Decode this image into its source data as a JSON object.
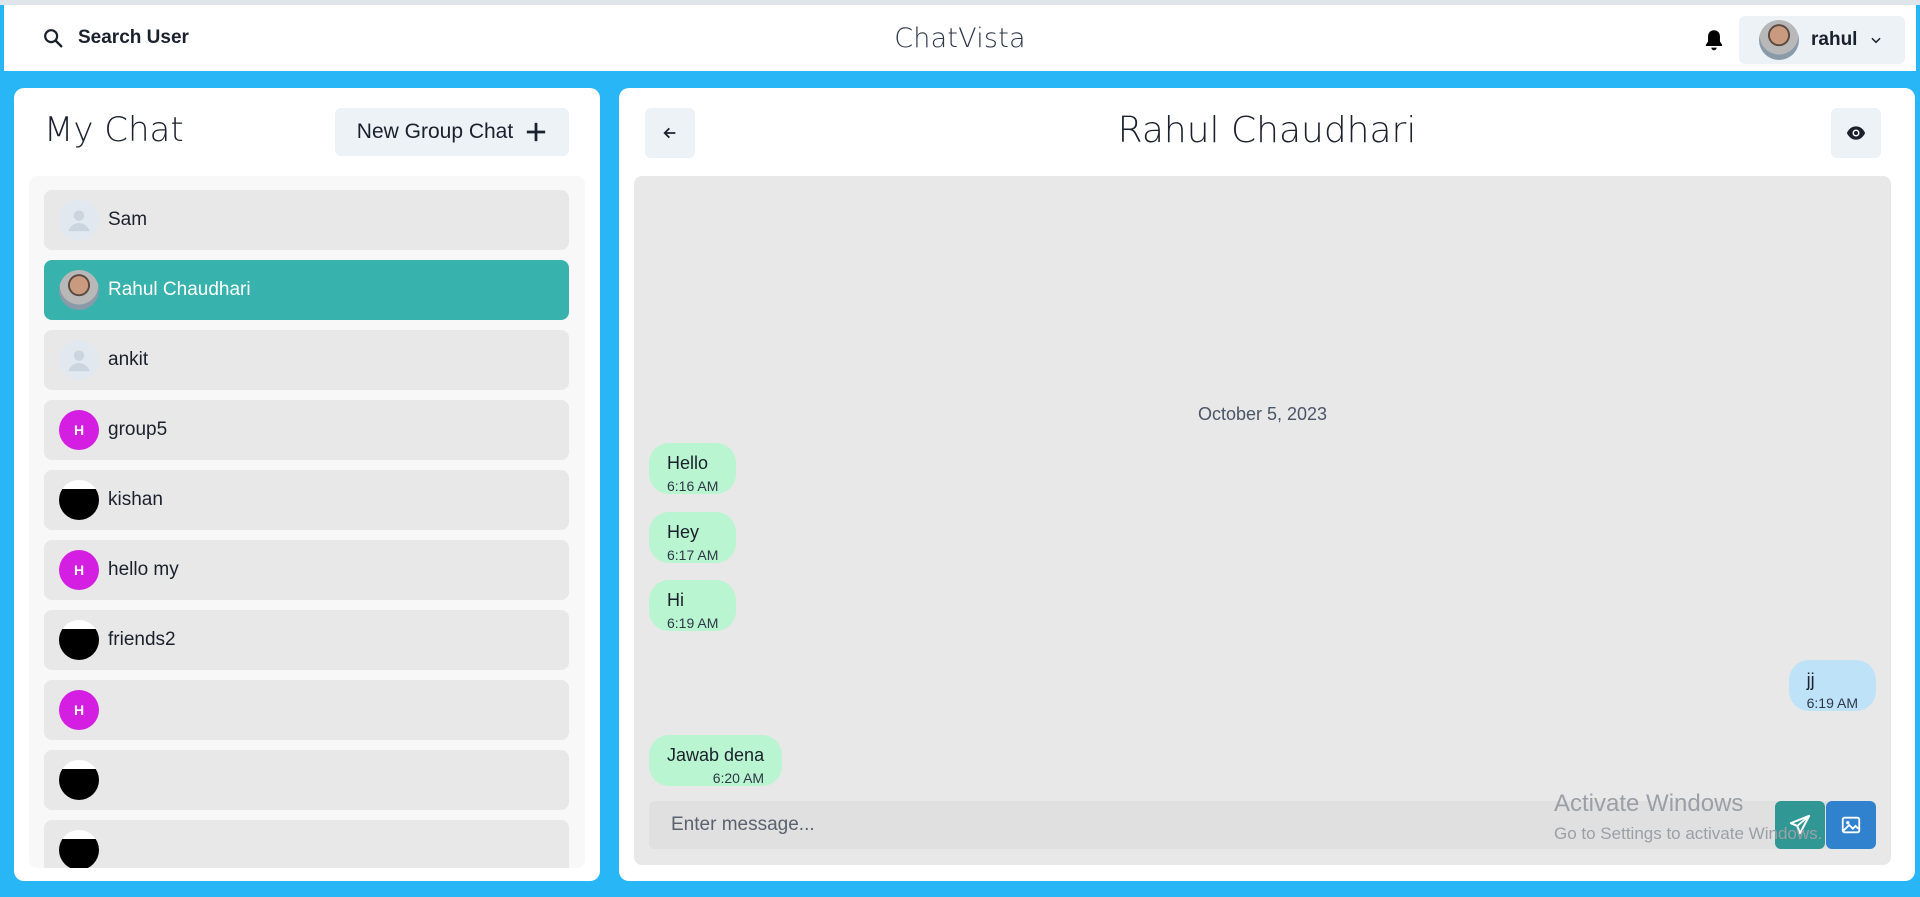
{
  "header": {
    "search_label": "Search User",
    "app_title": "ChatVista",
    "user_name": "rahul"
  },
  "sidebar": {
    "title": "My Chat",
    "new_group_label": "New Group Chat",
    "chats": [
      {
        "name": "Sam",
        "avatar": "default-user-icon",
        "active": false
      },
      {
        "name": "Rahul Chaudhari",
        "avatar": "photo",
        "active": true
      },
      {
        "name": "ankit",
        "avatar": "default-user-icon",
        "active": false
      },
      {
        "name": "group5",
        "avatar": "letter",
        "letter": "H",
        "active": false
      },
      {
        "name": "kishan",
        "avatar": "dark-image",
        "active": false
      },
      {
        "name": "hello my",
        "avatar": "letter",
        "letter": "H",
        "active": false
      },
      {
        "name": "friends2",
        "avatar": "dark-image",
        "active": false
      },
      {
        "name": "",
        "avatar": "letter",
        "letter": "H",
        "active": false
      },
      {
        "name": "",
        "avatar": "dark-image",
        "active": false
      },
      {
        "name": "",
        "avatar": "dark-image",
        "active": false
      }
    ]
  },
  "chat": {
    "title": "Rahul Chaudhari",
    "date": "October 5, 2023",
    "messages": [
      {
        "text": "Hello",
        "time": "6:16 AM",
        "direction": "in"
      },
      {
        "text": "Hey",
        "time": "6:17 AM",
        "direction": "in"
      },
      {
        "text": "Hi",
        "time": "6:19 AM",
        "direction": "in"
      },
      {
        "text": "jj",
        "time": "6:19 AM",
        "direction": "out"
      },
      {
        "text": "Jawab dena",
        "time": "6:20 AM",
        "direction": "in"
      }
    ],
    "input_placeholder": "Enter message..."
  },
  "watermark": {
    "title": "Activate Windows",
    "subtitle": "Go to Settings to activate Windows."
  },
  "colors": {
    "background": "#29b6f6",
    "active_chat": "#38b2ac",
    "incoming_bubble": "#b9f5d0",
    "outgoing_bubble": "#bee3f8",
    "letter_avatar": "#d41fe3",
    "send_button": "#319795",
    "image_button": "#3182ce"
  }
}
